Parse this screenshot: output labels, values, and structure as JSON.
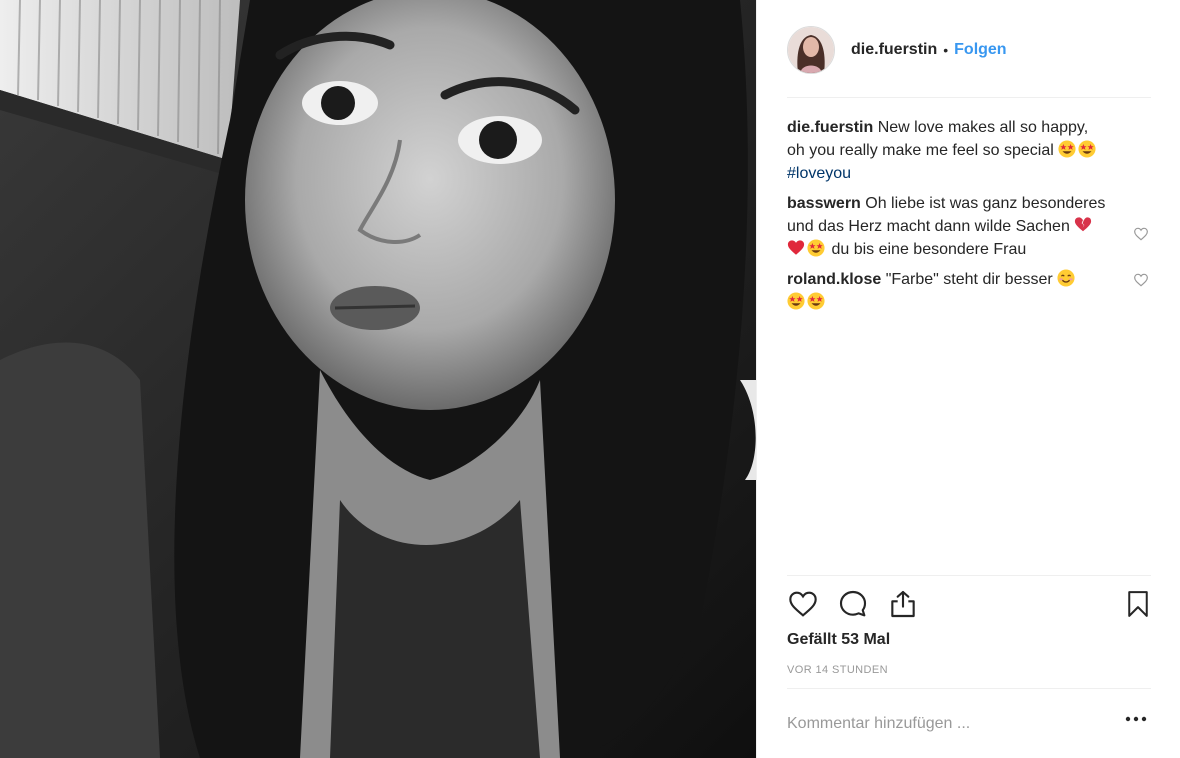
{
  "post": {
    "photo_alt": "",
    "header": {
      "username": "die.fuerstin",
      "separator": "•",
      "follow_label": "Folgen",
      "avatar_icon": "profile-photo"
    },
    "comments": [
      {
        "author": "die.fuerstin",
        "text": "New love makes all so happy, oh you really make me feel so special",
        "emojis": [
          "star-struck",
          "star-struck"
        ],
        "hashtag": "#loveyou"
      },
      {
        "author": "basswern",
        "text_before": "Oh liebe ist was ganz besonderes und das Herz macht dann wilde Sachen",
        "emojis": [
          "broken-heart",
          "red-heart",
          "star-struck"
        ],
        "text_after": "du bis eine besondere Frau"
      },
      {
        "author": "roland.klose",
        "text": "\"Farbe\" steht dir besser",
        "emojis": [
          "smiling-face",
          "star-struck",
          "star-struck"
        ]
      }
    ],
    "actions": {
      "like_icon": "heart-icon",
      "comment_icon": "comment-bubble-icon",
      "share_icon": "share-icon",
      "save_icon": "bookmark-icon"
    },
    "likes_text": "Gefällt 53 Mal",
    "timestamp": "VOR 14 STUNDEN",
    "add_comment": {
      "placeholder": "Kommentar hinzufügen ...",
      "more_icon": "more-options-icon"
    },
    "colors": {
      "link_blue": "#3897f0",
      "hashtag": "#003569",
      "text": "#262626",
      "muted": "#999999",
      "border": "#efefef"
    }
  }
}
